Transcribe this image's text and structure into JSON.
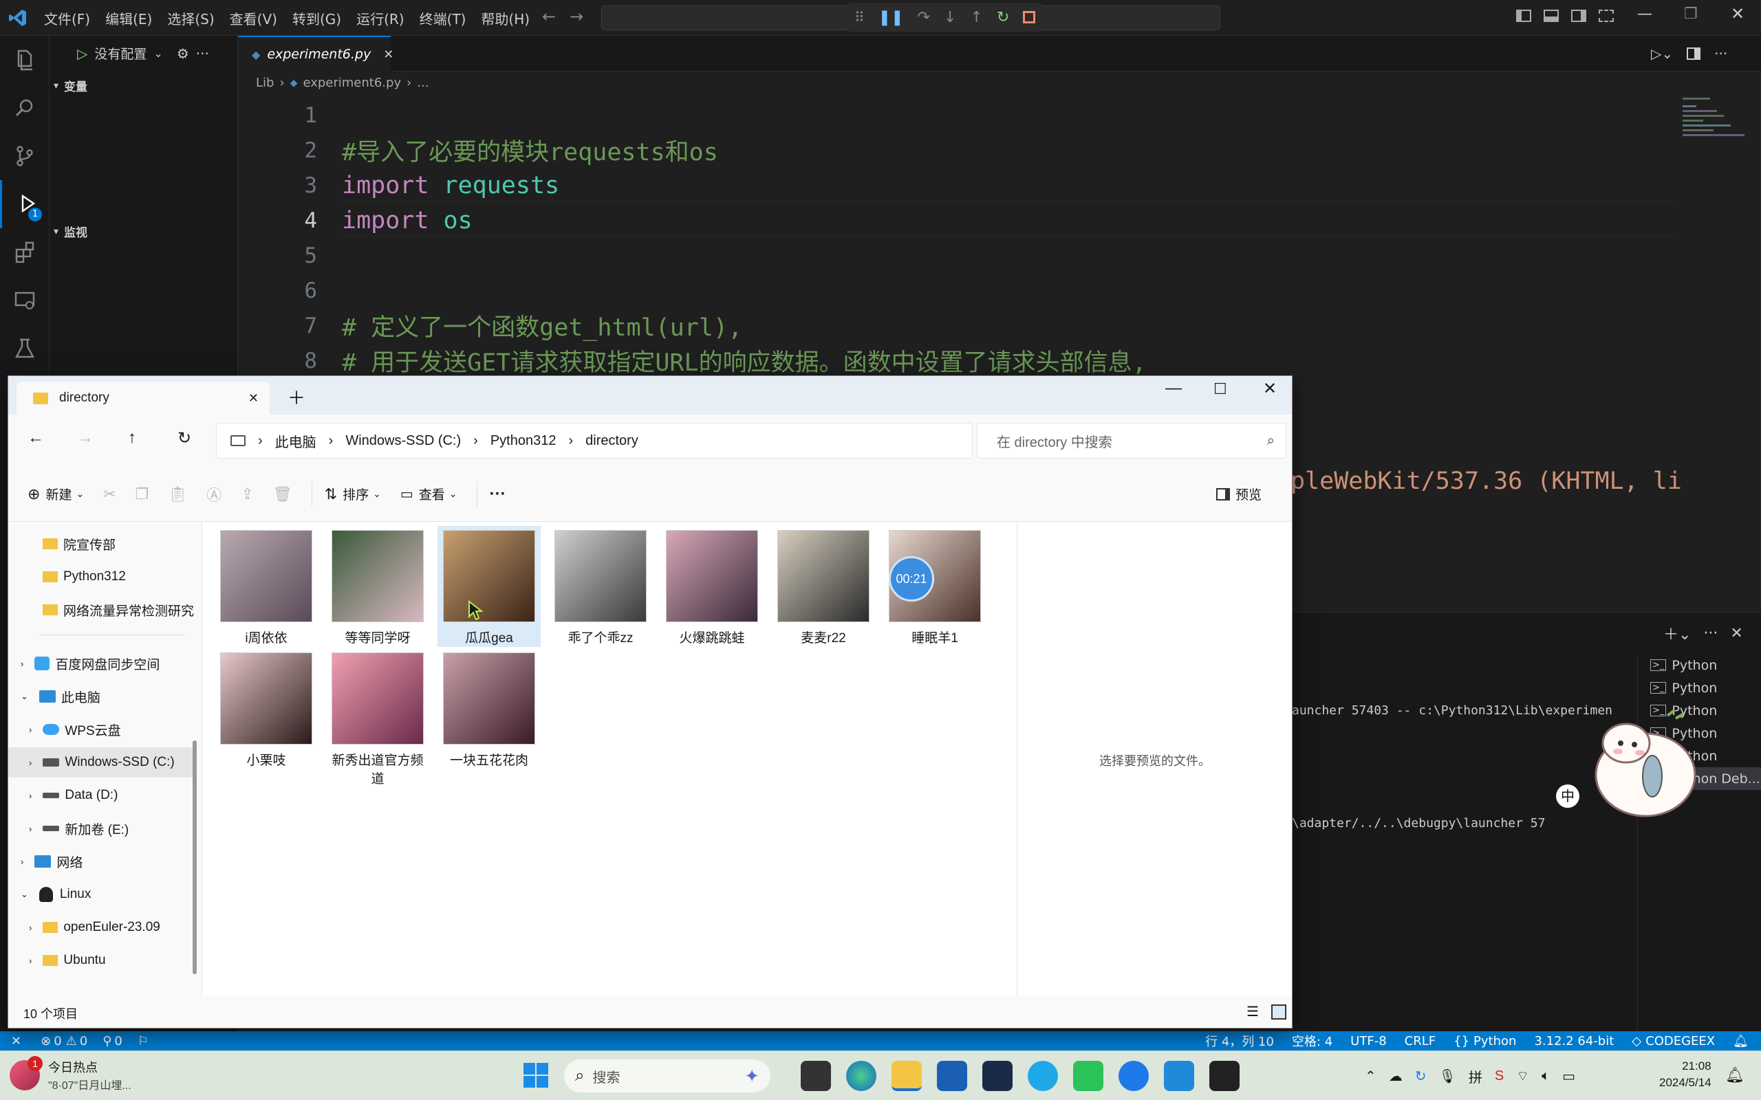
{
  "vscode": {
    "menu": [
      "文件(F)",
      "编辑(E)",
      "选择(S)",
      "查看(V)",
      "转到(G)",
      "运行(R)",
      "终端(T)",
      "帮助(H)"
    ],
    "debug_config": "没有配置",
    "sidebar_sections": {
      "variables": "变量",
      "watch": "监视"
    },
    "tab": {
      "filename": "experiment6.py"
    },
    "breadcrumb": [
      "Lib",
      "experiment6.py",
      "..."
    ],
    "code_lines": [
      {
        "n": "1",
        "parts": []
      },
      {
        "n": "2",
        "parts": [
          {
            "c": "cm",
            "t": "#导入了必要的模块requests和os"
          }
        ]
      },
      {
        "n": "3",
        "parts": [
          {
            "c": "kw",
            "t": "import "
          },
          {
            "c": "mod",
            "t": "requests"
          }
        ]
      },
      {
        "n": "4",
        "parts": [
          {
            "c": "kw",
            "t": "import "
          },
          {
            "c": "mod",
            "t": "os"
          }
        ]
      },
      {
        "n": "5",
        "parts": []
      },
      {
        "n": "6",
        "parts": []
      },
      {
        "n": "7",
        "parts": [
          {
            "c": "cm",
            "t": "# 定义了一个函数get_html(url),"
          }
        ]
      },
      {
        "n": "8",
        "parts": [
          {
            "c": "cm",
            "t": "# 用于发送GET请求获取指定URL的响应数据。函数中设置了请求头部信息,"
          }
        ]
      }
    ],
    "code_overflow": "pleWebKit/537.36 (KHTML, li",
    "terminal_lines": [
      "auncher 57403 -- c:\\Python312\\Lib\\experimen",
      "\\adapter/../..\\debugpy\\launcher 57"
    ],
    "terminal_tabs": [
      "Python",
      "Python",
      "Python",
      "Python",
      "Python",
      "Python Deb..."
    ],
    "ime_badge": "中",
    "status": {
      "errors": "0",
      "warnings": "0",
      "ports": "0",
      "position": "行 4，列 10",
      "spaces": "空格: 4",
      "encoding": "UTF-8",
      "eol": "CRLF",
      "language": "Python",
      "interpreter": "3.12.2 64-bit",
      "ext": "CODEGEEX"
    }
  },
  "explorer": {
    "tab_title": "directory",
    "breadcrumb": [
      "此电脑",
      "Windows-SSD (C:)",
      "Python312",
      "directory"
    ],
    "search_placeholder": "在 directory 中搜索",
    "toolbar": {
      "new": "新建",
      "sort": "排序",
      "view": "查看",
      "preview": "预览"
    },
    "nav": [
      "院宣传部",
      "Python312",
      "网络流量异常检测研究",
      "百度网盘同步空间",
      "此电脑",
      "WPS云盘",
      "Windows-SSD (C:)",
      "Data (D:)",
      "新加卷 (E:)",
      "网络",
      "Linux",
      "openEuler-23.09",
      "Ubuntu"
    ],
    "files": [
      "i周依依",
      "等等同学呀",
      "瓜瓜gea",
      "乖了个乖zz",
      "火爆跳跳蛙",
      "麦麦r22",
      "睡眠羊1",
      "小栗吱",
      "新秀出道官方频道",
      "一块五花花肉"
    ],
    "preview_hint": "选择要预览的文件。",
    "item_count": "10 个项目",
    "timer": "00:21"
  },
  "taskbar": {
    "news_title": "今日热点",
    "news_sub": "\"8·07\"日月山埋...",
    "news_badge": "1",
    "search": "搜索",
    "time": "21:08",
    "date": "2024/5/14"
  }
}
